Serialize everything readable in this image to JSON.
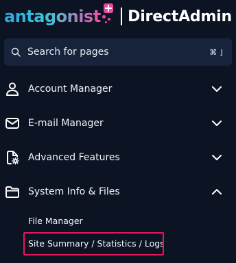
{
  "brand": {
    "primary": "antagonist",
    "secondary": "DirectAdmin",
    "accent_colors": [
      "#2aa7e0",
      "#f04fa4"
    ]
  },
  "search": {
    "placeholder": "Search for pages",
    "shortcut": "⌘ J",
    "icon": "search-icon"
  },
  "menu": [
    {
      "label": "Account Manager",
      "icon": "user-icon",
      "expanded": false
    },
    {
      "label": "E-mail Manager",
      "icon": "envelope-icon",
      "expanded": false
    },
    {
      "label": "Advanced Features",
      "icon": "file-gear-icon",
      "expanded": false
    },
    {
      "label": "System Info & Files",
      "icon": "folder-icon",
      "expanded": true
    }
  ],
  "submenu": [
    {
      "label": "File Manager"
    },
    {
      "label": "Site Summary / Statistics / Logs",
      "highlighted": true
    }
  ],
  "colors": {
    "background": "#0c1424",
    "search_bg": "#16233a",
    "highlight": "#e8175d"
  }
}
